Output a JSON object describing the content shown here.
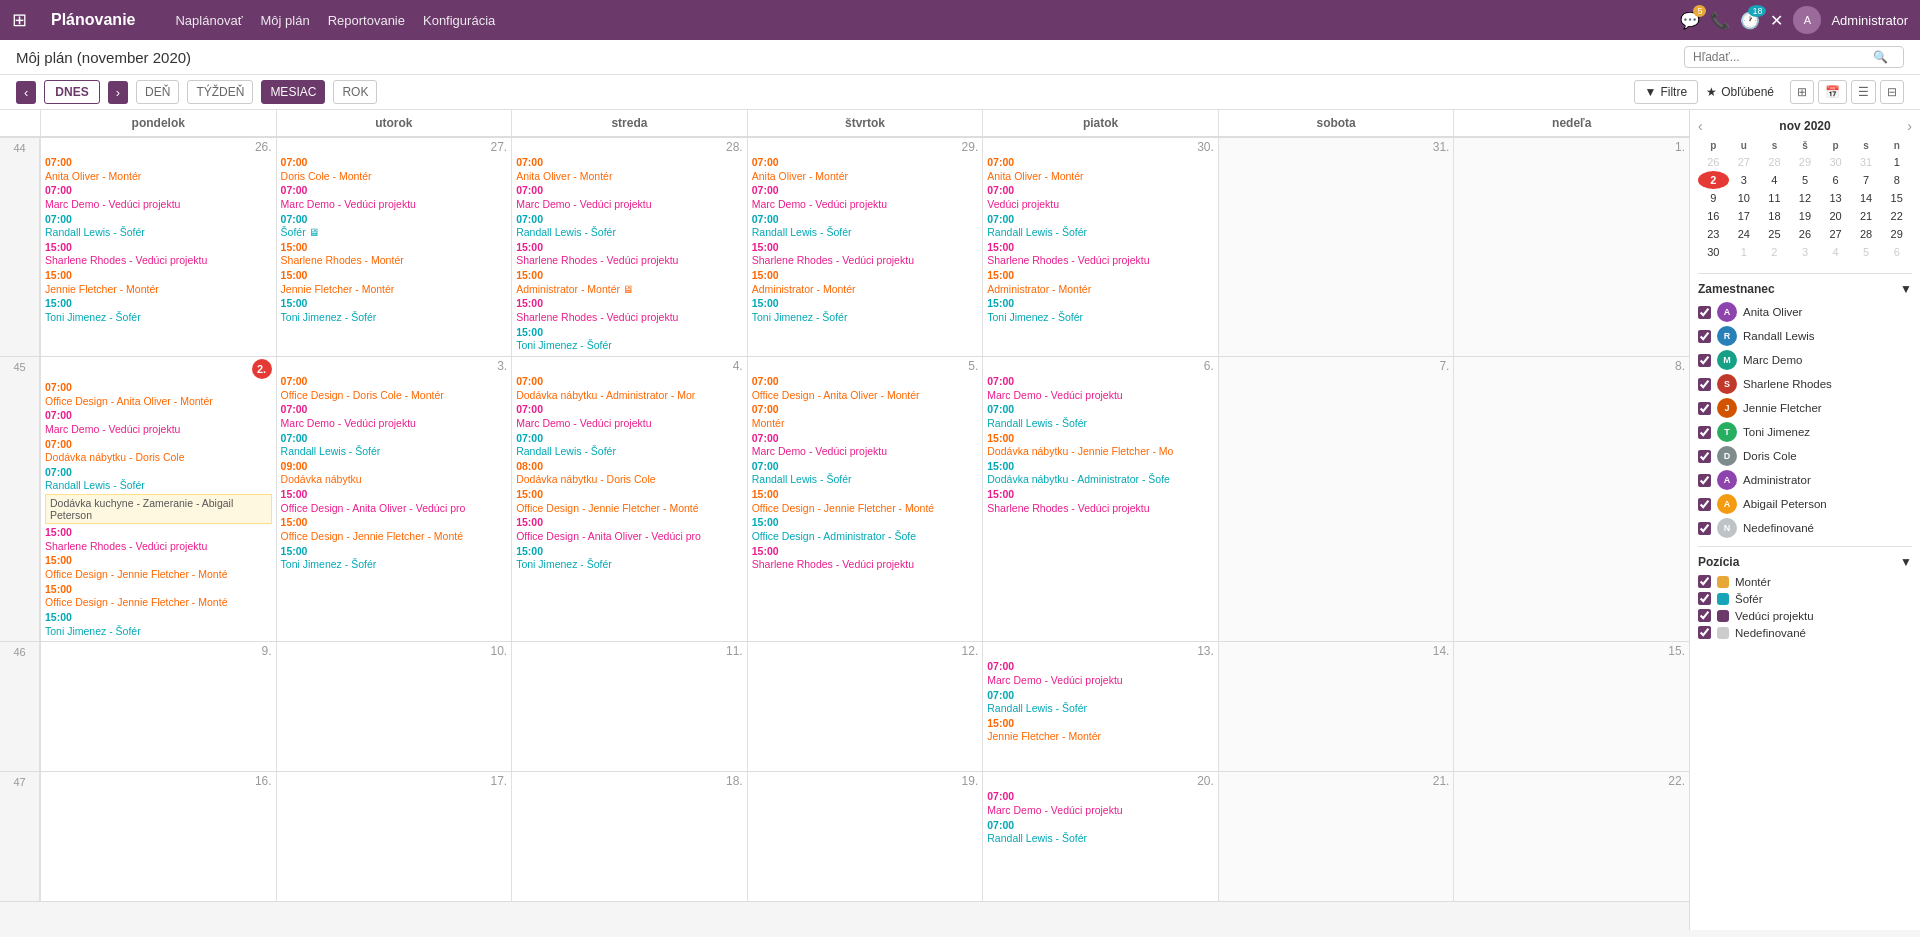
{
  "app": {
    "title": "Plánovanie",
    "nav_links": [
      "Naplánovať",
      "Môj plán",
      "Reportovanie",
      "Konfigurácia"
    ],
    "admin_label": "Administrator"
  },
  "header": {
    "page_title": "Môj plán (november 2020)",
    "search_placeholder": "Hľadať..."
  },
  "toolbar": {
    "today": "DNES",
    "day": "DEŇ",
    "week": "TÝŽDEŇ",
    "month": "MESIAC",
    "year": "ROK",
    "filter": "Filtre",
    "favorite": "Obľúbené"
  },
  "day_headers": [
    "pondelok",
    "utorok",
    "streda",
    "štvrtok",
    "piatok",
    "sobota",
    "nedeľa"
  ],
  "mini_cal": {
    "title": "nov 2020",
    "day_headers": [
      "p",
      "u",
      "s",
      "š",
      "p",
      "s",
      "n"
    ],
    "weeks": [
      [
        "26",
        "27",
        "28",
        "29",
        "30",
        "31",
        "1"
      ],
      [
        "2",
        "3",
        "4",
        "5",
        "6",
        "7",
        "8"
      ],
      [
        "9",
        "10",
        "11",
        "12",
        "13",
        "14",
        "15"
      ],
      [
        "16",
        "17",
        "18",
        "19",
        "20",
        "21",
        "22"
      ],
      [
        "23",
        "24",
        "25",
        "26",
        "27",
        "28",
        "29"
      ],
      [
        "30",
        "1",
        "2",
        "3",
        "4",
        "5",
        "6"
      ]
    ],
    "other_month_indices": {
      "0": [
        0,
        1,
        2,
        3,
        4,
        5
      ],
      "5": [
        1,
        2,
        3,
        4,
        5,
        6
      ]
    },
    "today": "2"
  },
  "employees": [
    {
      "name": "Anita Oliver",
      "class": "av",
      "checked": true
    },
    {
      "name": "Randall Lewis",
      "class": "rl",
      "checked": true
    },
    {
      "name": "Marc Demo",
      "class": "md",
      "checked": true
    },
    {
      "name": "Sharlene Rhodes",
      "class": "sr",
      "checked": true
    },
    {
      "name": "Jennie Fletcher",
      "class": "jf",
      "checked": true
    },
    {
      "name": "Toni Jimenez",
      "class": "tj",
      "checked": true
    },
    {
      "name": "Doris Cole",
      "class": "dc",
      "checked": true
    },
    {
      "name": "Administrator",
      "class": "adm",
      "checked": true
    },
    {
      "name": "Abigail Peterson",
      "class": "ap",
      "checked": true
    },
    {
      "name": "Nedefinované",
      "class": "nd",
      "checked": true
    }
  ],
  "positions": [
    {
      "name": "Montér",
      "color": "#e8a838",
      "checked": true
    },
    {
      "name": "Šofér",
      "color": "#17a3b8",
      "checked": true
    },
    {
      "name": "Vedúci projektu",
      "color": "#6b3a6b",
      "checked": true
    },
    {
      "name": "Nedefinované",
      "color": "#ccc",
      "checked": true
    }
  ],
  "weeks": [
    {
      "num": "44",
      "days": [
        {
          "date": "26.",
          "other": false,
          "events": [
            {
              "time": "07:00",
              "text": "Anita Oliver - Montér",
              "color": "orange"
            },
            {
              "time": "07:00",
              "text": "Marc Demo - Vedúci projektu",
              "color": "pink"
            },
            {
              "time": "07:00",
              "text": "Randall Lewis - Šofér",
              "color": "cyan"
            },
            {
              "time": "15:00",
              "text": "Sharlene Rhodes - Vedúci projektu",
              "color": "pink"
            },
            {
              "time": "15:00",
              "text": "Jennie Fletcher - Montér",
              "color": "orange"
            },
            {
              "time": "15:00",
              "text": "Toni Jimenez - Šofér",
              "color": "cyan"
            }
          ]
        },
        {
          "date": "27.",
          "other": false,
          "events": [
            {
              "time": "07:00",
              "text": "Doris Cole - Montér",
              "color": "orange"
            },
            {
              "time": "07:00",
              "text": "Marc Demo - Vedúci projektu",
              "color": "pink"
            },
            {
              "time": "07:00",
              "text": "Šofér 🖥",
              "color": "cyan"
            },
            {
              "time": "15:00",
              "text": "Sharlene Rhodes - Montér",
              "color": "orange"
            },
            {
              "time": "15:00",
              "text": "Jennie Fletcher - Montér",
              "color": "orange"
            },
            {
              "time": "15:00",
              "text": "Toni Jimenez - Šofér",
              "color": "cyan"
            }
          ]
        },
        {
          "date": "28.",
          "other": false,
          "events": [
            {
              "time": "07:00",
              "text": "Anita Oliver - Montér",
              "color": "orange"
            },
            {
              "time": "07:00",
              "text": "Marc Demo - Vedúci projektu",
              "color": "pink"
            },
            {
              "time": "07:00",
              "text": "Randall Lewis - Šofér",
              "color": "cyan"
            },
            {
              "time": "15:00",
              "text": "Sharlene Rhodes - Vedúci projektu",
              "color": "pink"
            },
            {
              "time": "15:00",
              "text": "Administrator - Montér 🖥",
              "color": "orange"
            },
            {
              "time": "15:00",
              "text": "Sharlene Rhodes - Vedúci projektu",
              "color": "pink"
            },
            {
              "time": "15:00",
              "text": "Toni Jimenez - Šofér",
              "color": "cyan"
            }
          ]
        },
        {
          "date": "29.",
          "other": false,
          "events": [
            {
              "time": "07:00",
              "text": "Anita Oliver - Montér",
              "color": "orange"
            },
            {
              "time": "07:00",
              "text": "Marc Demo - Vedúci projektu",
              "color": "pink"
            },
            {
              "time": "07:00",
              "text": "Randall Lewis - Šofér",
              "color": "cyan"
            },
            {
              "time": "15:00",
              "text": "Sharlene Rhodes - Vedúci projektu",
              "color": "pink"
            },
            {
              "time": "15:00",
              "text": "Administrator - Montér",
              "color": "orange"
            },
            {
              "time": "15:00",
              "text": "Toni Jimenez - Šofér",
              "color": "cyan"
            }
          ]
        },
        {
          "date": "30.",
          "other": false,
          "events": [
            {
              "time": "07:00",
              "text": "Anita Oliver - Montér",
              "color": "orange"
            },
            {
              "time": "07:00",
              "text": "Vedúci projektu",
              "color": "pink"
            },
            {
              "time": "07:00",
              "text": "Randall Lewis - Šofér",
              "color": "cyan"
            },
            {
              "time": "15:00",
              "text": "Sharlene Rhodes - Vedúci projektu",
              "color": "pink"
            },
            {
              "time": "15:00",
              "text": "Administrator - Montér",
              "color": "orange"
            },
            {
              "time": "15:00",
              "text": "Toni Jimenez - Šofér",
              "color": "cyan"
            }
          ]
        },
        {
          "date": "31.",
          "other": true,
          "events": []
        },
        {
          "date": "1.",
          "other": true,
          "events": []
        }
      ]
    },
    {
      "num": "45",
      "today_badge": "2.",
      "days": [
        {
          "date": "2.",
          "today": true,
          "events": [
            {
              "time": "07:00",
              "text": "Office Design - Anita Oliver - Montér",
              "color": "orange"
            },
            {
              "time": "07:00",
              "text": "Marc Demo - Vedúci projektu",
              "color": "pink"
            },
            {
              "time": "07:00",
              "text": "Dodávka nábytku - Doris Cole",
              "color": "cyan"
            },
            {
              "time": "07:00",
              "text": "Randall Lewis - Šofér",
              "color": "cyan"
            },
            {
              "all_day": true,
              "text": "Dodávka kuchyne - Zameranie - Abigail Peterson"
            },
            {
              "time": "15:00",
              "text": "Sharlene Rhodes - Vedúci projektu",
              "color": "pink"
            },
            {
              "time": "15:00",
              "text": "Office Design - Jennie Fletcher - Monté",
              "color": "orange"
            },
            {
              "time": "15:00",
              "text": "Office Design - Jennie Fletcher - Monté",
              "color": "orange"
            },
            {
              "time": "15:00",
              "text": "Toni Jimenez - Šofér",
              "color": "cyan"
            }
          ]
        },
        {
          "date": "3.",
          "events": [
            {
              "time": "07:00",
              "text": "Office Design - Doris Cole - Montér",
              "color": "orange"
            },
            {
              "time": "07:00",
              "text": "Marc Demo - Vedúci projektu",
              "color": "pink"
            },
            {
              "time": "07:00",
              "text": "Randall Lewis - Šofér",
              "color": "cyan"
            },
            {
              "time": "09:00",
              "text": "Dodávka nábytku",
              "color": "orange"
            },
            {
              "time": "15:00",
              "text": "Office Design - Anita Oliver - Vedúci pro",
              "color": "pink"
            },
            {
              "time": "15:00",
              "text": "Office Design - Jennie Fletcher - Monté",
              "color": "orange"
            },
            {
              "time": "15:00",
              "text": "Toni Jimenez - Šofér",
              "color": "cyan"
            }
          ]
        },
        {
          "date": "4.",
          "events": [
            {
              "time": "07:00",
              "text": "Dodávka nábytku - Administrator - Mor",
              "color": "orange"
            },
            {
              "time": "07:00",
              "text": "Marc Demo - Vedúci projektu",
              "color": "pink"
            },
            {
              "time": "07:00",
              "text": "Randall Lewis - Šofér",
              "color": "cyan"
            },
            {
              "time": "08:00",
              "text": "Dodávka nábytku - Doris Cole",
              "color": "orange"
            },
            {
              "time": "15:00",
              "text": "Office Design - Jennie Fletcher - Monté",
              "color": "orange"
            },
            {
              "time": "15:00",
              "text": "Office Design - Anita Oliver - Vedúci pro",
              "color": "pink"
            },
            {
              "time": "15:00",
              "text": "Toni Jimenez - Šofér",
              "color": "cyan"
            }
          ]
        },
        {
          "date": "5.",
          "events": [
            {
              "time": "07:00",
              "text": "Office Design - Anita Oliver - Montér",
              "color": "orange"
            },
            {
              "time": "07:00",
              "text": "Montér",
              "color": "orange"
            },
            {
              "time": "07:00",
              "text": "Marc Demo - Vedúci projektu",
              "color": "pink"
            },
            {
              "time": "07:00",
              "text": "Randall Lewis - Šofér",
              "color": "cyan"
            },
            {
              "time": "15:00",
              "text": "Office Design - Jennie Fletcher - Monté",
              "color": "orange"
            },
            {
              "time": "15:00",
              "text": "Office Design - Administrator - Šofe",
              "color": "cyan"
            },
            {
              "time": "15:00",
              "text": "Sharlene Rhodes - Vedúci projektu",
              "color": "pink"
            }
          ]
        },
        {
          "date": "6.",
          "events": [
            {
              "time": "07:00",
              "text": "Marc Demo - Vedúci projektu",
              "color": "pink"
            },
            {
              "time": "07:00",
              "text": "Randall Lewis - Šofér",
              "color": "cyan"
            },
            {
              "time": "15:00",
              "text": "Dodávka nábytku - Jennie Fletcher - Mo",
              "color": "orange"
            },
            {
              "time": "15:00",
              "text": "Dodávka nábytku - Administrator - Šofe",
              "color": "cyan"
            },
            {
              "time": "15:00",
              "text": "Sharlene Rhodes - Vedúci projektu",
              "color": "pink"
            }
          ]
        },
        {
          "date": "7.",
          "other": true,
          "events": []
        },
        {
          "date": "8.",
          "other": true,
          "events": []
        }
      ]
    },
    {
      "num": "46",
      "days": [
        {
          "date": "9.",
          "events": []
        },
        {
          "date": "10.",
          "events": []
        },
        {
          "date": "11.",
          "events": []
        },
        {
          "date": "12.",
          "events": []
        },
        {
          "date": "13.",
          "events": [
            {
              "time": "07:00",
              "text": "Marc Demo - Vedúci projektu",
              "color": "pink"
            },
            {
              "time": "07:00",
              "text": "Randall Lewis - Šofér",
              "color": "cyan"
            },
            {
              "time": "15:00",
              "text": "Jennie Fletcher - Montér",
              "color": "orange"
            }
          ]
        },
        {
          "date": "14.",
          "other": true,
          "events": []
        },
        {
          "date": "15.",
          "other": true,
          "events": []
        }
      ]
    },
    {
      "num": "47",
      "days": [
        {
          "date": "16.",
          "events": []
        },
        {
          "date": "17.",
          "events": []
        },
        {
          "date": "18.",
          "events": []
        },
        {
          "date": "19.",
          "events": []
        },
        {
          "date": "20.",
          "events": [
            {
              "time": "07:00",
              "text": "Marc Demo - Vedúci projektu",
              "color": "pink"
            },
            {
              "time": "07:00",
              "text": "Randall Lewis - Šofér",
              "color": "cyan"
            }
          ]
        },
        {
          "date": "21.",
          "other": true,
          "events": []
        },
        {
          "date": "22.",
          "other": true,
          "events": []
        }
      ]
    }
  ]
}
